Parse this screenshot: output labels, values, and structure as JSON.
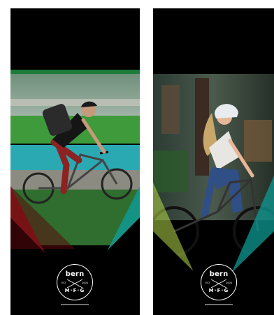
{
  "banners": [
    {
      "id": "left",
      "logo": {
        "brand": "bern",
        "est": "EST",
        "year": "2004",
        "mfg": "M·F·G"
      }
    },
    {
      "id": "right",
      "logo": {
        "brand": "bern",
        "est": "EST",
        "year": "2004",
        "mfg": "M·F·G"
      }
    }
  ],
  "colors": {
    "accent_green": "#1c7a3a",
    "accent_red": "#b0121a",
    "accent_teal": "#0f9a93"
  }
}
